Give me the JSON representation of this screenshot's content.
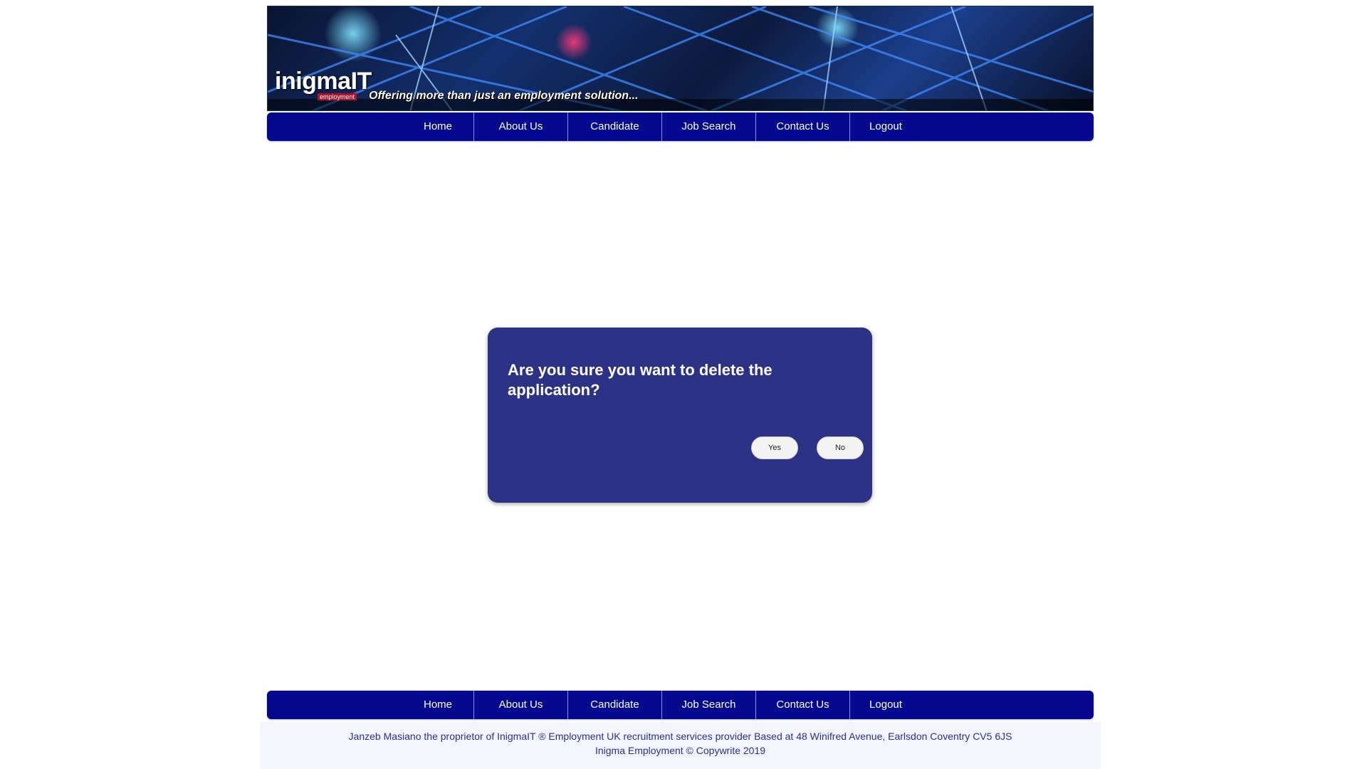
{
  "header": {
    "logo_text": "inigmaIT",
    "logo_sub": "employment",
    "tagline": "Offering more than just an employment solution..."
  },
  "nav": {
    "items": [
      "Home",
      "About Us",
      "Candidate",
      "Job Search",
      "Contact Us",
      "Logout"
    ]
  },
  "dialog": {
    "message": "Are you sure you want to delete the application?",
    "yes_label": "Yes",
    "no_label": "No"
  },
  "footer": {
    "line1": "Janzeb Masiano the proprietor of InigmaIT ® Employment UK recruitment services provider Based at 48 Winifred Avenue, Earlsdon Coventry CV5 6JS",
    "line2": "Inigma Employment © Copywrite 2019"
  },
  "colors": {
    "nav_bg": "#04098f",
    "dialog_bg": "#2c3386",
    "footer_text": "#24309a"
  }
}
